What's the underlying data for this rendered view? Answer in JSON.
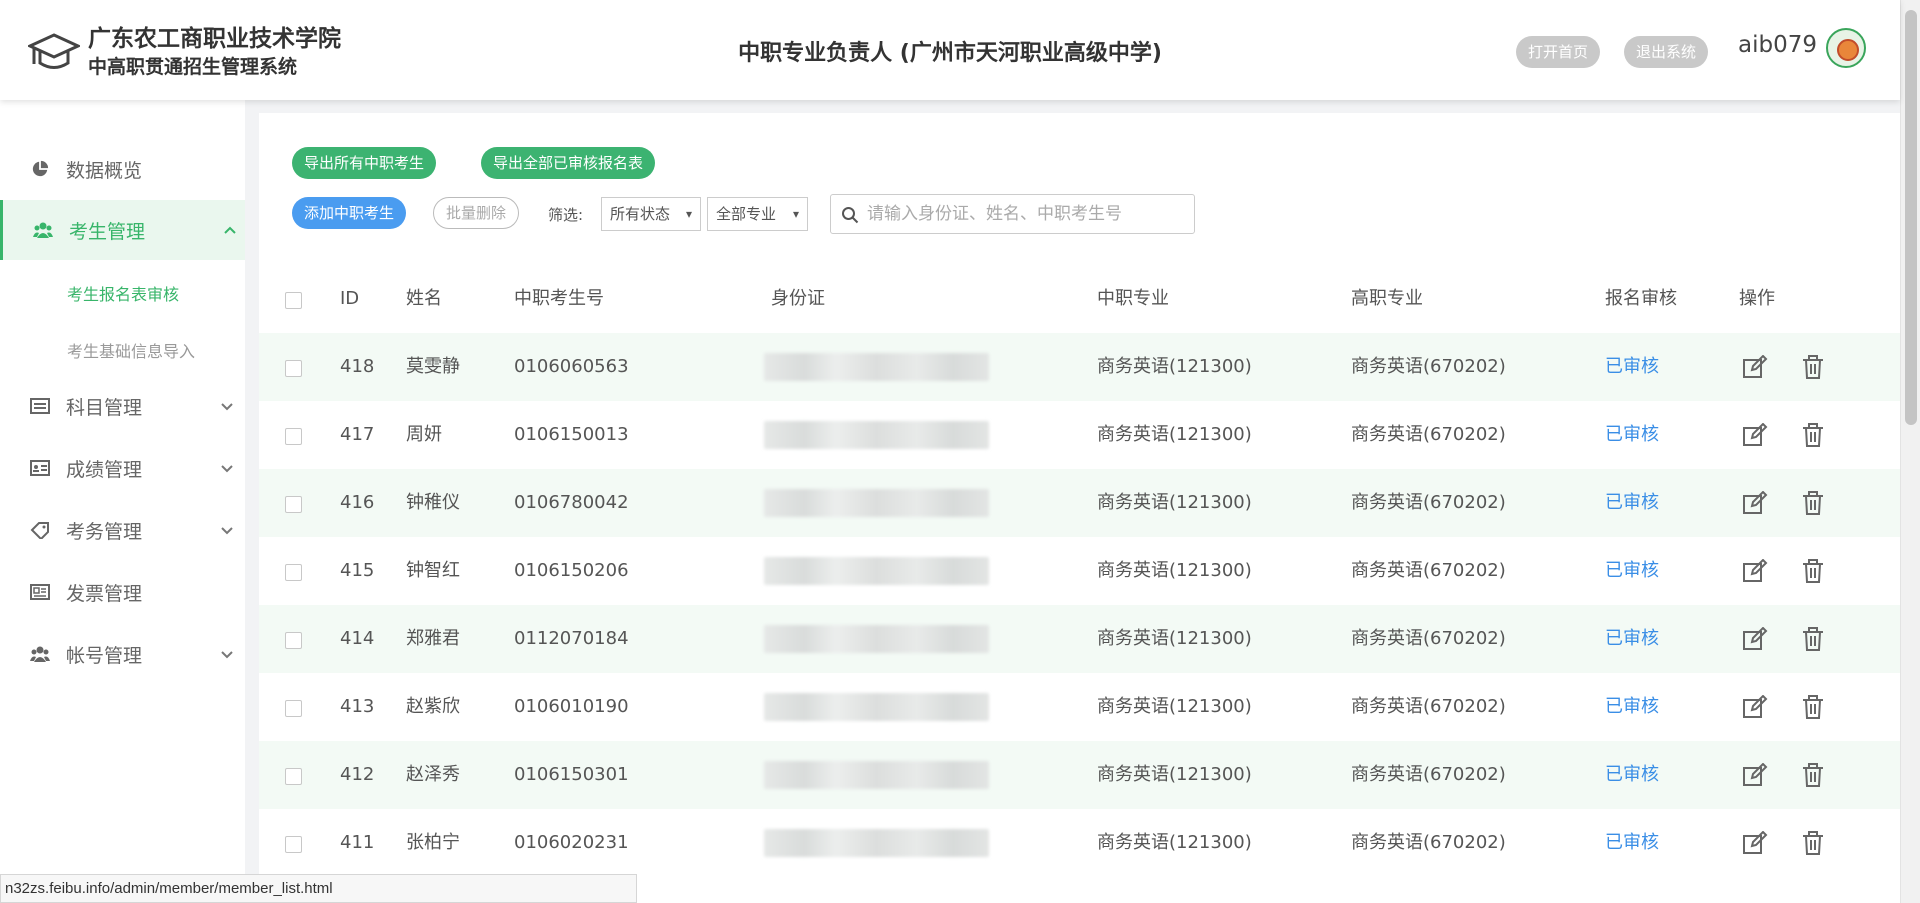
{
  "header": {
    "school_name": "广东农工商职业技术学院",
    "system_name": "中高职贯通招生管理系统",
    "role_title": "中职专业负责人 (广州市天河职业高级中学)",
    "home_button": "打开首页",
    "logout_button": "退出系统",
    "username": "aib079"
  },
  "sidebar": {
    "items": [
      {
        "label": "数据概览",
        "icon": "pie-chart-icon"
      },
      {
        "label": "考生管理",
        "icon": "users-icon",
        "active": true
      },
      {
        "label": "科目管理",
        "icon": "list-icon"
      },
      {
        "label": "成绩管理",
        "icon": "id-card-icon"
      },
      {
        "label": "考务管理",
        "icon": "tag-icon"
      },
      {
        "label": "发票管理",
        "icon": "receipt-icon"
      },
      {
        "label": "帐号管理",
        "icon": "users-icon"
      }
    ],
    "sub_items": [
      {
        "label": "考生报名表审核",
        "active": true
      },
      {
        "label": "考生基础信息导入",
        "active": false
      }
    ]
  },
  "toolbar": {
    "export_all": "导出所有中职考生",
    "export_audited": "导出全部已审核报名表",
    "add_student": "添加中职考生",
    "batch_delete": "批量删除",
    "filter_label": "筛选:",
    "status_select": "所有状态",
    "major_select": "全部专业",
    "search_placeholder": "请输入身份证、姓名、中职考生号"
  },
  "table": {
    "columns": [
      "ID",
      "姓名",
      "中职考生号",
      "身份证",
      "中职专业",
      "高职专业",
      "报名审核",
      "操作"
    ],
    "rows": [
      {
        "id": "418",
        "name": "莫雯静",
        "exam_no": "0106060563",
        "sec_major": "商务英语(121300)",
        "high_major": "商务英语(670202)",
        "status": "已审核"
      },
      {
        "id": "417",
        "name": "周妍",
        "exam_no": "0106150013",
        "sec_major": "商务英语(121300)",
        "high_major": "商务英语(670202)",
        "status": "已审核"
      },
      {
        "id": "416",
        "name": "钟稚仪",
        "exam_no": "0106780042",
        "sec_major": "商务英语(121300)",
        "high_major": "商务英语(670202)",
        "status": "已审核"
      },
      {
        "id": "415",
        "name": "钟智红",
        "exam_no": "0106150206",
        "sec_major": "商务英语(121300)",
        "high_major": "商务英语(670202)",
        "status": "已审核"
      },
      {
        "id": "414",
        "name": "郑雅君",
        "exam_no": "0112070184",
        "sec_major": "商务英语(121300)",
        "high_major": "商务英语(670202)",
        "status": "已审核"
      },
      {
        "id": "413",
        "name": "赵紫欣",
        "exam_no": "0106010190",
        "sec_major": "商务英语(121300)",
        "high_major": "商务英语(670202)",
        "status": "已审核"
      },
      {
        "id": "412",
        "name": "赵泽秀",
        "exam_no": "0106150301",
        "sec_major": "商务英语(121300)",
        "high_major": "商务英语(670202)",
        "status": "已审核"
      },
      {
        "id": "411",
        "name": "张柏宁",
        "exam_no": "0106020231",
        "sec_major": "商务英语(121300)",
        "high_major": "商务英语(670202)",
        "status": "已审核"
      }
    ]
  },
  "statusbar": {
    "url": "n32zs.feibu.info/admin/member/member_list.html"
  }
}
